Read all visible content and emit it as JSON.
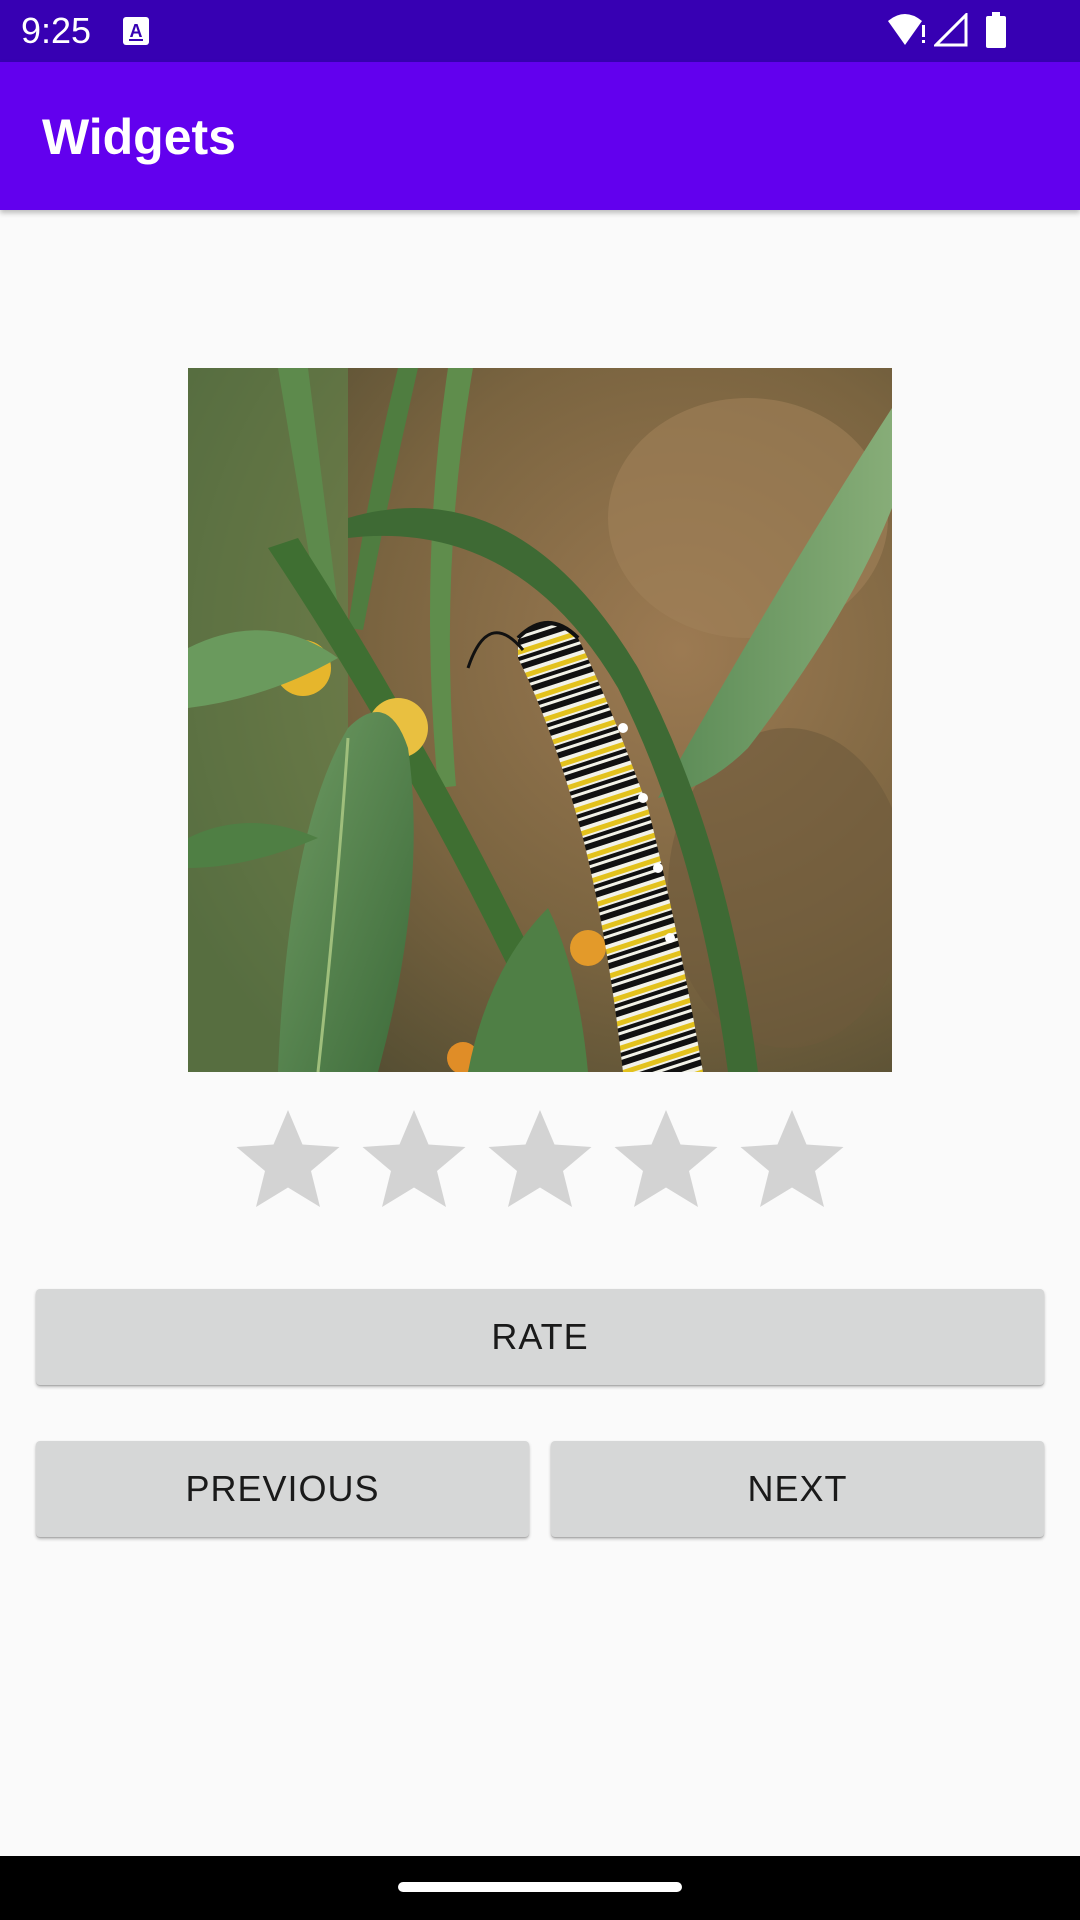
{
  "status_bar": {
    "time": "9:25",
    "icons": [
      "keyboard-a-icon",
      "wifi-icon",
      "cell-signal-icon",
      "battery-icon"
    ],
    "background": "#3700b3"
  },
  "app_bar": {
    "title": "Widgets",
    "background": "#6200ee"
  },
  "image": {
    "subject": "caterpillar-photo"
  },
  "rating": {
    "max_stars": 5,
    "value": 0,
    "star_color": "#d3d3d3"
  },
  "buttons": {
    "rate": "RATE",
    "previous": "PREVIOUS",
    "next": "NEXT"
  },
  "colors": {
    "button_bg": "#d6d7d7",
    "page_bg": "#fafafa"
  }
}
